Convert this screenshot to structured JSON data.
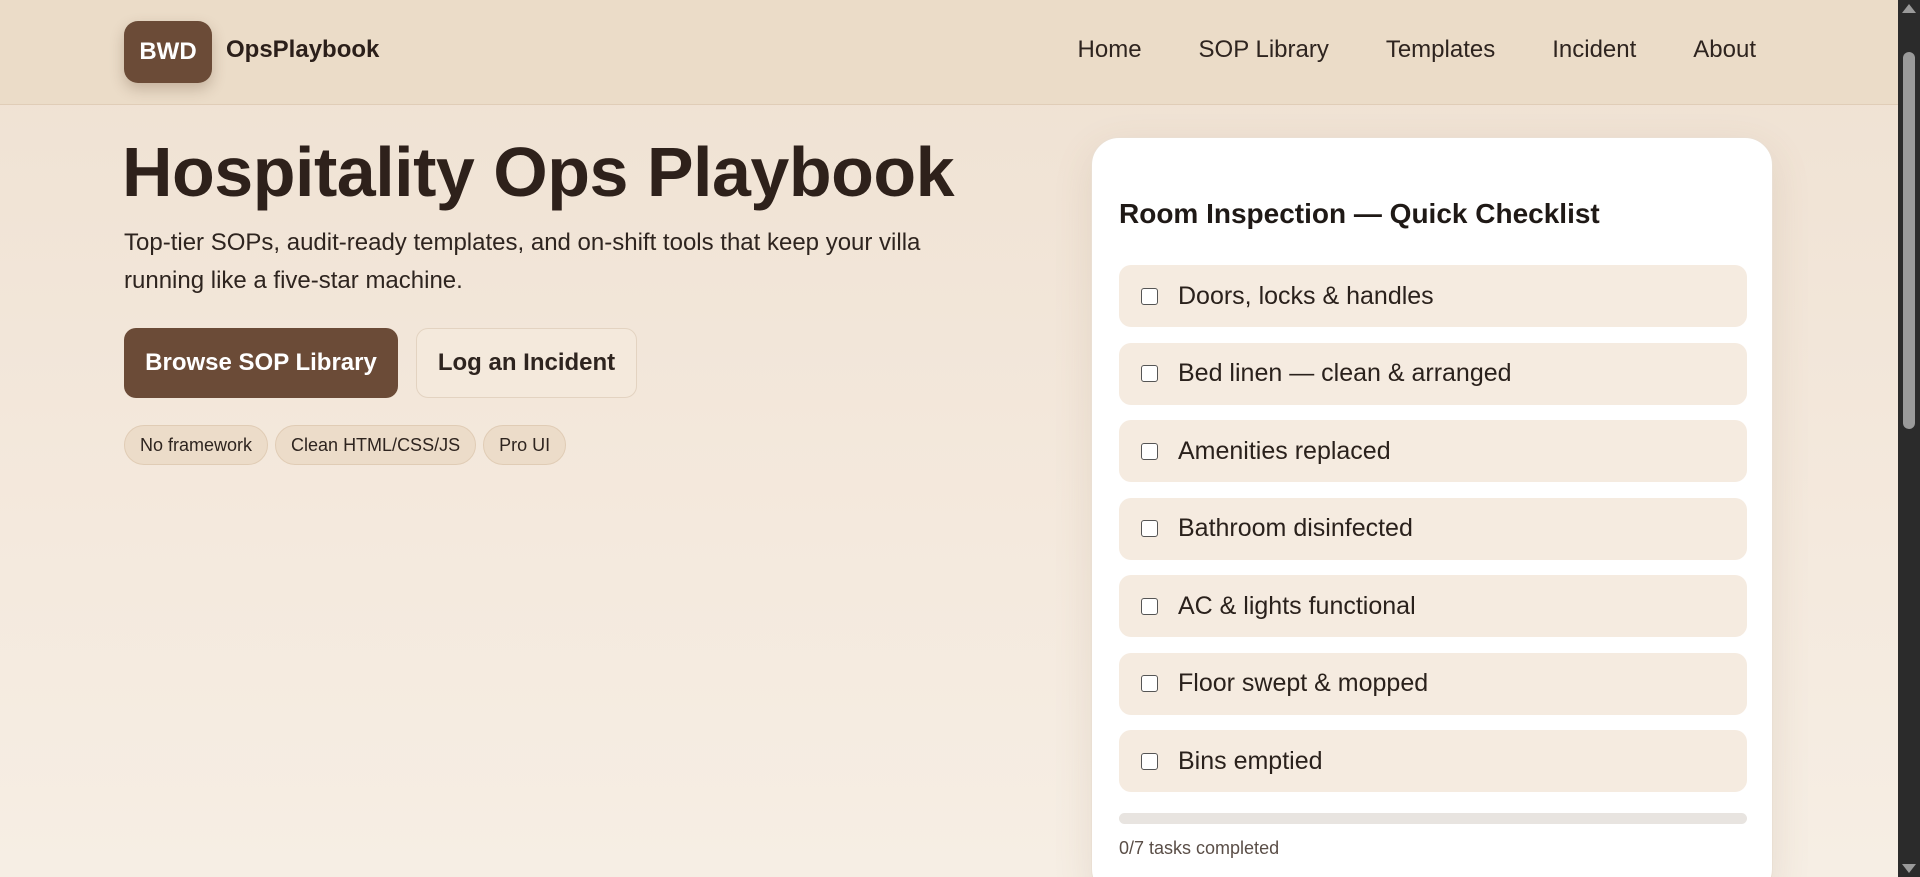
{
  "header": {
    "logo_text": "BWD",
    "brand": "OpsPlaybook",
    "nav": [
      "Home",
      "SOP Library",
      "Templates",
      "Incident",
      "About"
    ]
  },
  "hero": {
    "title": "Hospitality Ops Playbook",
    "subtitle": "Top-tier SOPs, audit-ready templates, and on-shift tools that keep your villa running like a five-star machine.",
    "primary_button": "Browse SOP Library",
    "secondary_button": "Log an Incident",
    "chips": [
      "No framework",
      "Clean HTML/CSS/JS",
      "Pro UI"
    ]
  },
  "checklist": {
    "title": "Room Inspection — Quick Checklist",
    "items": [
      {
        "label": "Doors, locks & handles",
        "checked": false
      },
      {
        "label": "Bed linen — clean & arranged",
        "checked": false
      },
      {
        "label": "Amenities replaced",
        "checked": false
      },
      {
        "label": "Bathroom disinfected",
        "checked": false
      },
      {
        "label": "AC & lights functional",
        "checked": false
      },
      {
        "label": "Floor swept & mopped",
        "checked": false
      },
      {
        "label": "Bins emptied",
        "checked": false
      }
    ],
    "progress_fraction": 0,
    "progress_text": "0/7 tasks completed"
  },
  "colors": {
    "accent": "#6b4b37",
    "header_bg": "#ebdcc8",
    "item_bg": "#f5ebe0"
  }
}
